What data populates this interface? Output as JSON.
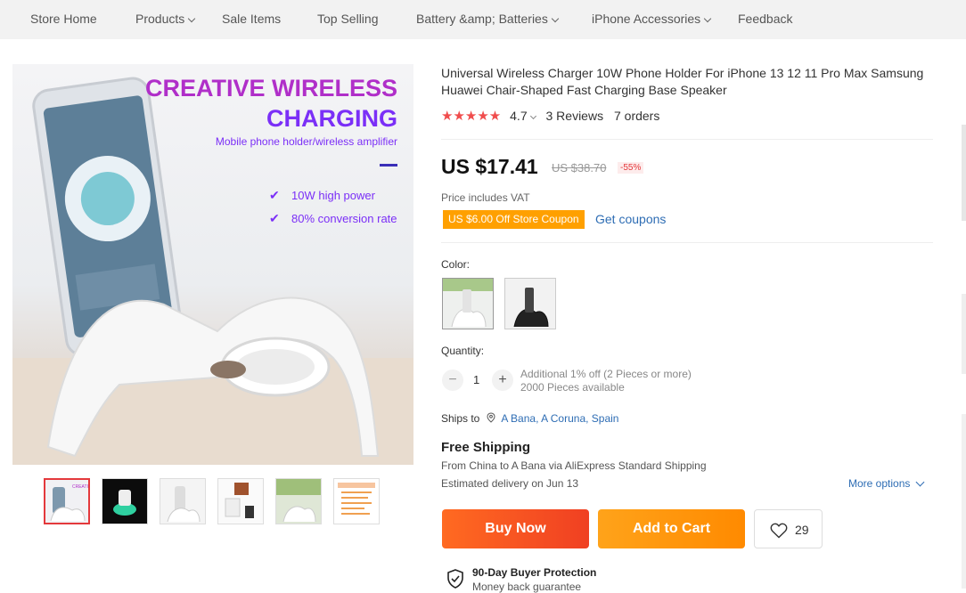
{
  "nav": {
    "items": [
      {
        "label": "Store Home",
        "dropdown": false
      },
      {
        "label": "Products",
        "dropdown": true
      },
      {
        "label": "Sale Items",
        "dropdown": false
      },
      {
        "label": "Top Selling",
        "dropdown": false
      },
      {
        "label": "Battery &amp; Batteries",
        "dropdown": true
      },
      {
        "label": "iPhone Accessories",
        "dropdown": true
      },
      {
        "label": "Feedback",
        "dropdown": false
      }
    ]
  },
  "gallery": {
    "banner_line1": "CREATIVE WIRELESS",
    "banner_line2": "CHARGING",
    "banner_sub": "Mobile phone holder/wireless amplifier",
    "feature1": "10W high power",
    "feature2": "80% conversion rate",
    "thumbnail_count": 6
  },
  "product": {
    "title": "Universal Wireless Charger 10W Phone Holder For iPhone 13 12 11 Pro Max Samsung Huawei Chair-Shaped Fast Charging Base Speaker",
    "rating": "4.7",
    "reviews": "3 Reviews",
    "orders": "7 orders",
    "price": "US $17.41",
    "old_price": "US $38.70",
    "discount": "-55%",
    "vat_note": "Price includes VAT",
    "coupon": "US $6.00 Off Store Coupon",
    "get_coupons": "Get coupons",
    "color_label": "Color:",
    "quantity_label": "Quantity:",
    "quantity": "1",
    "quantity_minus": "−",
    "quantity_plus": "+",
    "bulk_note": "Additional 1% off (2 Pieces or more)",
    "available": "2000 Pieces available"
  },
  "shipping": {
    "ships_to_label": "Ships to",
    "location": "A Bana, A Coruna, Spain",
    "free_shipping": "Free Shipping",
    "from": "From China to A Bana via AliExpress Standard Shipping",
    "estimated": "Estimated delivery on Jun 13",
    "more_options": "More options"
  },
  "actions": {
    "buy_now": "Buy Now",
    "add_to_cart": "Add to Cart",
    "wishlist_count": "29"
  },
  "protection": {
    "title": "90-Day Buyer Protection",
    "subtitle": "Money back guarantee"
  },
  "colors": {
    "accent_red": "#f04022",
    "accent_orange": "#ff8a00",
    "link_blue": "#2e6db4",
    "star_red": "#f04c4c",
    "banner_purple": "#7b2ff7",
    "banner_magenta": "#c92fbf"
  }
}
